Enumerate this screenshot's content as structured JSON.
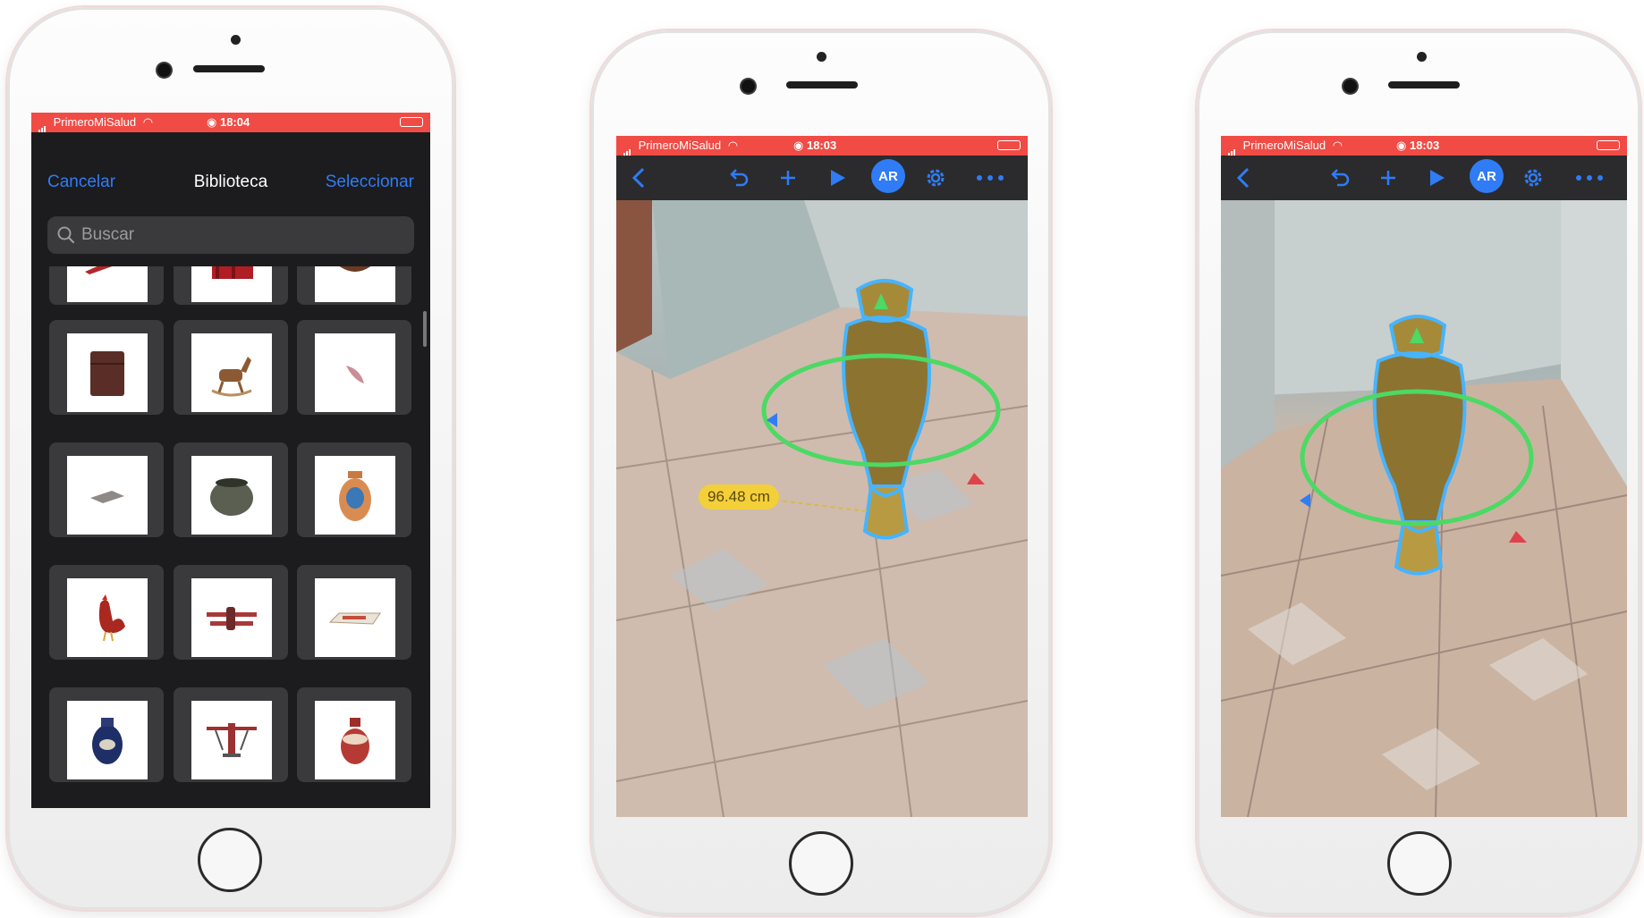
{
  "status": {
    "carrier": "PrimeroMiSalud",
    "time_library": "18:04",
    "time_ar": "18:03"
  },
  "library": {
    "cancel_label": "Cancelar",
    "title": "Biblioteca",
    "select_label": "Seleccionar",
    "search_placeholder": "Buscar",
    "items": [
      {
        "icon": "red-object-icon"
      },
      {
        "icon": "red-box-icon"
      },
      {
        "icon": "saddle-icon"
      },
      {
        "icon": "wooden-chest-icon"
      },
      {
        "icon": "rocking-horse-icon"
      },
      {
        "icon": "feather-icon"
      },
      {
        "icon": "flat-tray-icon"
      },
      {
        "icon": "clay-pot-icon"
      },
      {
        "icon": "painted-vase-icon"
      },
      {
        "icon": "rooster-icon"
      },
      {
        "icon": "biplane-icon"
      },
      {
        "icon": "sign-board-icon"
      },
      {
        "icon": "blue-vase-icon"
      },
      {
        "icon": "airplane-icon"
      },
      {
        "icon": "red-vase-icon"
      }
    ]
  },
  "ar_view": {
    "toolbar_icons": [
      "back-icon",
      "undo-icon",
      "add-icon",
      "play-icon",
      "ar-button",
      "settings-icon",
      "more-icon"
    ],
    "ar_label": "AR",
    "measurement": "96.48 cm"
  },
  "colors": {
    "status_bar": "#f04b45",
    "accent": "#2f7cf6",
    "toolbar_bg": "#2b2b2d",
    "selection_ring": "#4cd964",
    "outline": "#46b4ff",
    "measure_badge": "#f3cf3a"
  }
}
